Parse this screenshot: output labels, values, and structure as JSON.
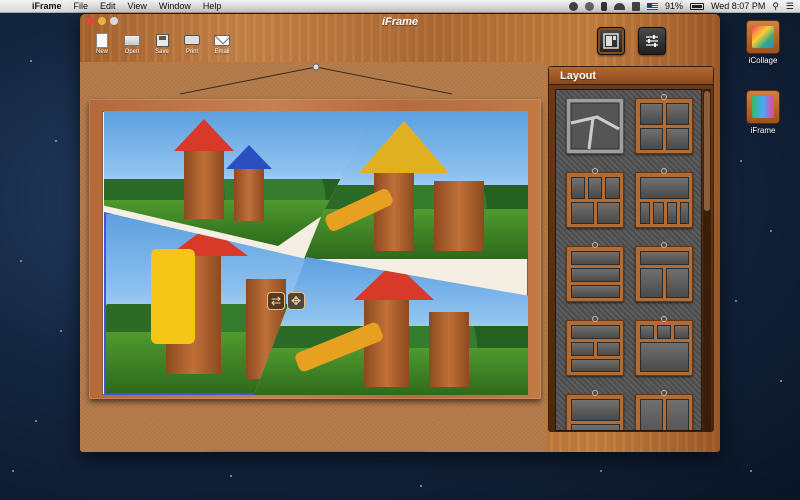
{
  "menubar": {
    "app_name": "iFrame",
    "menus": [
      "File",
      "Edit",
      "View",
      "Window",
      "Help"
    ],
    "battery": "91%",
    "clock": "Wed 8:07 PM"
  },
  "window": {
    "title": "iFrame",
    "toolbar": [
      {
        "label": "New",
        "icon": "new-file-icon"
      },
      {
        "label": "Open",
        "icon": "folder-icon"
      },
      {
        "label": "Save",
        "icon": "floppy-icon"
      },
      {
        "label": "Print",
        "icon": "printer-icon"
      },
      {
        "label": "Email",
        "icon": "envelope-icon"
      }
    ],
    "mode_buttons": [
      {
        "icon": "layout-icon",
        "active": true
      },
      {
        "icon": "sliders-icon",
        "active": false
      }
    ]
  },
  "layout_panel": {
    "header": "Layout",
    "selected_index": 0,
    "count": 10
  },
  "edit_toolbar": [
    {
      "icon": "undo-icon",
      "glyph": "↩"
    },
    {
      "icon": "redo-icon",
      "glyph": "↪"
    },
    {
      "icon": "trash-icon",
      "glyph": "🗑"
    },
    {
      "icon": "refresh-icon",
      "glyph": "⟳"
    },
    {
      "icon": "rotate-icon",
      "glyph": "◈"
    },
    {
      "icon": "flip-horizontal-icon",
      "glyph": "◧"
    },
    {
      "icon": "flip-vertical-icon",
      "glyph": "⬒"
    },
    {
      "icon": "rotate-right-icon",
      "glyph": "↻"
    }
  ],
  "desktop_icons": [
    {
      "label": "iCollage",
      "icon": "icollage-app-icon"
    },
    {
      "label": "iFrame",
      "icon": "iframe-app-icon"
    }
  ],
  "colors": {
    "wood": "#b5693a",
    "selection_border": "#3c58d8",
    "slide_yellow": "#f5c518"
  }
}
